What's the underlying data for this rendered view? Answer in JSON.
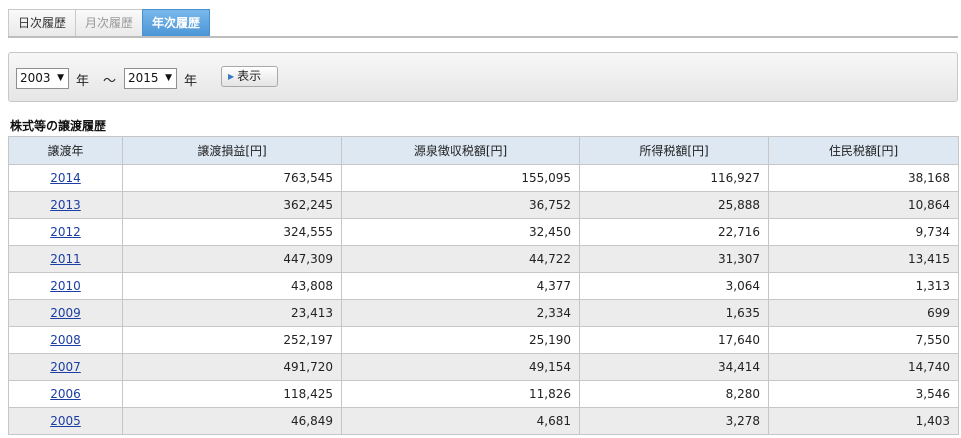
{
  "tabs": [
    {
      "label": "日次履歴",
      "state": "normal"
    },
    {
      "label": "月次履歴",
      "state": "inactive"
    },
    {
      "label": "年次履歴",
      "state": "active"
    }
  ],
  "filter": {
    "from_year": "2003",
    "year_unit_1": "年",
    "range_sep": "～",
    "to_year": "2015",
    "year_unit_2": "年",
    "show_button": "表示"
  },
  "section_title": "株式等の譲渡履歴",
  "table": {
    "headers": [
      "譲渡年",
      "譲渡損益[円]",
      "源泉徴収税額[円]",
      "所得税額[円]",
      "住民税額[円]"
    ],
    "rows": [
      {
        "year": "2014",
        "gain": "763,545",
        "withholding": "155,095",
        "income_tax": "116,927",
        "resident_tax": "38,168"
      },
      {
        "year": "2013",
        "gain": "362,245",
        "withholding": "36,752",
        "income_tax": "25,888",
        "resident_tax": "10,864"
      },
      {
        "year": "2012",
        "gain": "324,555",
        "withholding": "32,450",
        "income_tax": "22,716",
        "resident_tax": "9,734"
      },
      {
        "year": "2011",
        "gain": "447,309",
        "withholding": "44,722",
        "income_tax": "31,307",
        "resident_tax": "13,415"
      },
      {
        "year": "2010",
        "gain": "43,808",
        "withholding": "4,377",
        "income_tax": "3,064",
        "resident_tax": "1,313"
      },
      {
        "year": "2009",
        "gain": "23,413",
        "withholding": "2,334",
        "income_tax": "1,635",
        "resident_tax": "699"
      },
      {
        "year": "2008",
        "gain": "252,197",
        "withholding": "25,190",
        "income_tax": "17,640",
        "resident_tax": "7,550"
      },
      {
        "year": "2007",
        "gain": "491,720",
        "withholding": "49,154",
        "income_tax": "34,414",
        "resident_tax": "14,740"
      },
      {
        "year": "2006",
        "gain": "118,425",
        "withholding": "11,826",
        "income_tax": "8,280",
        "resident_tax": "3,546"
      },
      {
        "year": "2005",
        "gain": "46,849",
        "withholding": "4,681",
        "income_tax": "3,278",
        "resident_tax": "1,403"
      }
    ]
  }
}
